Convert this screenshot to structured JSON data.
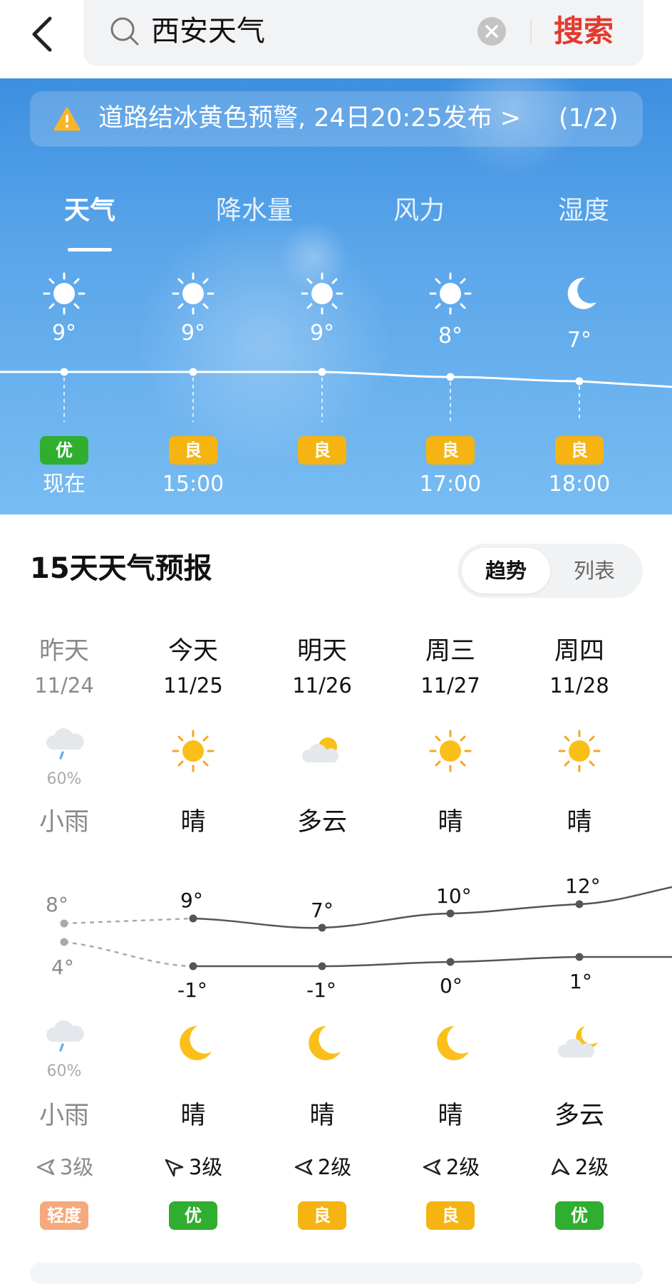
{
  "search": {
    "query": "西安天气",
    "button": "搜索"
  },
  "alert": {
    "text": "道路结冰黄色预警, 24日20:25发布 >",
    "count": "(1/2)"
  },
  "tabs": [
    "天气",
    "降水量",
    "风力",
    "湿度"
  ],
  "hourly": [
    {
      "icon": "sun-icon",
      "temp": "9°",
      "aqi": "优",
      "aqi_color": "#2fae2f",
      "time": "现在"
    },
    {
      "icon": "sun-icon",
      "temp": "9°",
      "aqi": "良",
      "aqi_color": "#f5b412",
      "time": "15:00"
    },
    {
      "icon": "sun-icon",
      "temp": "9°",
      "aqi": "良",
      "aqi_color": "#f5b412",
      "time": ""
    },
    {
      "icon": "sun-icon",
      "temp": "8°",
      "aqi": "良",
      "aqi_color": "#f5b412",
      "time": "17:00"
    },
    {
      "icon": "moon-icon",
      "temp": "7°",
      "aqi": "良",
      "aqi_color": "#f5b412",
      "time": "18:00"
    }
  ],
  "forecast": {
    "title": "15天天气预报",
    "toggle": [
      "趋势",
      "列表"
    ],
    "days": [
      {
        "day": "昨天",
        "date": "11/24",
        "day_icon": "rain-cloud-icon",
        "day_pct": "60%",
        "day_cond": "小雨",
        "high": "8°",
        "low": "4°",
        "night_icon": "rain-cloud-icon",
        "night_pct": "60%",
        "night_cond": "小雨",
        "wind": "3级",
        "aqi": "轻度",
        "aqi_color": "#f6a97c",
        "past": true
      },
      {
        "day": "今天",
        "date": "11/25",
        "day_icon": "sun-icon",
        "day_pct": "",
        "day_cond": "晴",
        "high": "9°",
        "low": "-1°",
        "night_icon": "moon-icon",
        "night_pct": "",
        "night_cond": "晴",
        "wind": "3级",
        "aqi": "优",
        "aqi_color": "#2fae2f",
        "past": false
      },
      {
        "day": "明天",
        "date": "11/26",
        "day_icon": "cloud-sun-icon",
        "day_pct": "",
        "day_cond": "多云",
        "high": "7°",
        "low": "-1°",
        "night_icon": "moon-icon",
        "night_pct": "",
        "night_cond": "晴",
        "wind": "2级",
        "aqi": "良",
        "aqi_color": "#f5b412",
        "past": false
      },
      {
        "day": "周三",
        "date": "11/27",
        "day_icon": "sun-icon",
        "day_pct": "",
        "day_cond": "晴",
        "high": "10°",
        "low": "0°",
        "night_icon": "moon-icon",
        "night_pct": "",
        "night_cond": "晴",
        "wind": "2级",
        "aqi": "良",
        "aqi_color": "#f5b412",
        "past": false
      },
      {
        "day": "周四",
        "date": "11/28",
        "day_icon": "sun-icon",
        "day_pct": "",
        "day_cond": "晴",
        "high": "12°",
        "low": "1°",
        "night_icon": "cloud-moon-icon",
        "night_pct": "",
        "night_cond": "多云",
        "wind": "2级",
        "aqi": "优",
        "aqi_color": "#2fae2f",
        "past": false
      }
    ]
  }
}
